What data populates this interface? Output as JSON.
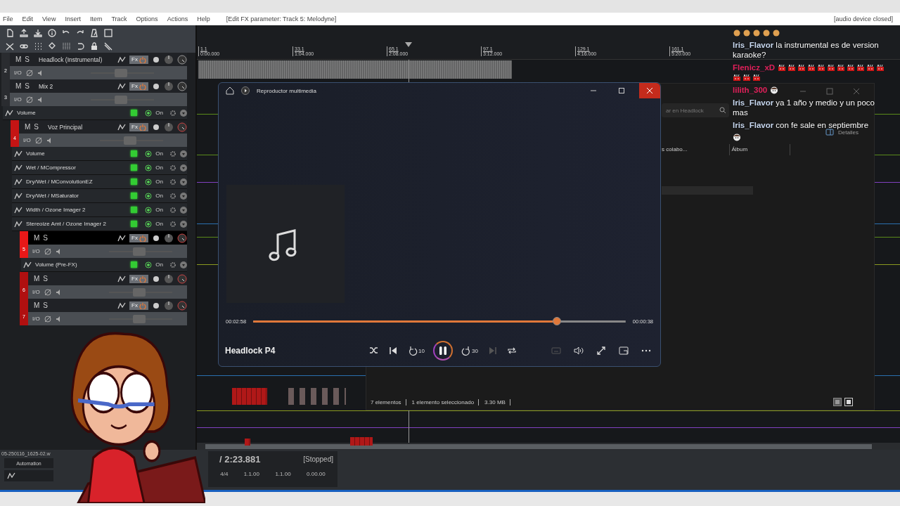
{
  "menu_bar": {
    "items": [
      "File",
      "Edit",
      "View",
      "Insert",
      "Item",
      "Track",
      "Options",
      "Actions",
      "Help"
    ],
    "title": "[Edit FX parameter: Track 5: Melodyne]",
    "status": "[audio device closed]"
  },
  "tracks": [
    {
      "number": "2",
      "name": "Headlock (Instrumental)",
      "mute": "M",
      "solo": "S",
      "fx": "Fx",
      "io": "I/O",
      "selected": false
    },
    {
      "number": "3",
      "name": "Mix 2",
      "mute": "M",
      "solo": "S",
      "fx": "Fx",
      "io": "I/O",
      "selected": false,
      "envelopes": [
        {
          "name": "Volume",
          "on": "On"
        }
      ],
      "children": [
        {
          "number": "4",
          "name": "Voz Principal",
          "color": "#c41414",
          "mute": "M",
          "solo": "S",
          "fx": "Fx",
          "io": "I/O",
          "selected": false,
          "envelopes": [
            {
              "name": "Volume",
              "on": "On"
            },
            {
              "name": "Wet / MCompressor",
              "on": "On"
            },
            {
              "name": "Dry/Wet / MConvolutionEZ",
              "on": "On"
            },
            {
              "name": "Dry/Wet / MSaturator",
              "on": "On"
            },
            {
              "name": "Width / Ozone Imager 2",
              "on": "On"
            },
            {
              "name": "Stereoize Amt / Ozone Imager 2",
              "on": "On"
            }
          ],
          "children": [
            {
              "number": "5",
              "color": "#e81818",
              "mute": "M",
              "solo": "S",
              "fx": "Fx",
              "io": "I/O",
              "selected": true,
              "envelopes": [
                {
                  "name": "Volume (Pre-FX)",
                  "on": "On"
                }
              ]
            },
            {
              "number": "6",
              "color": "#b01010",
              "mute": "M",
              "solo": "S",
              "fx": "Fx",
              "io": "I/O",
              "selected": false
            },
            {
              "number": "7",
              "color": "#b01010",
              "mute": "M",
              "solo": "S",
              "fx": "Fx",
              "io": "I/O",
              "selected": false
            }
          ]
        }
      ]
    }
  ],
  "ruler": {
    "markers": [
      {
        "bar": "1.1",
        "time": "0:00.000"
      },
      {
        "bar": "33.1",
        "time": "1:04.000"
      },
      {
        "bar": "65.1",
        "time": "2:08.000"
      },
      {
        "bar": "97.1",
        "time": "3:12.000"
      },
      {
        "bar": "129.1",
        "time": "4:16.000"
      },
      {
        "bar": "161.1",
        "time": "5:20.000"
      }
    ]
  },
  "bottom_panel": {
    "file_name": "05-250116_1625-02.w",
    "automation_button": "Automation",
    "position": "/ 2:23.881",
    "state": "[Stopped]",
    "readouts": [
      "4/4",
      "1.1.00",
      "1.1.00",
      "0.00.00"
    ]
  },
  "explorer": {
    "columns": [
      "s colabo...",
      "Álbum"
    ],
    "search": {
      "placeholder": "ar en Headlock"
    },
    "details_button": "Detalles",
    "status": [
      "7 elementos",
      "1 elemento seleccionado",
      "3.30 MB"
    ]
  },
  "media_player": {
    "title": "Reproductor multimedia",
    "elapsed": "00:02:58",
    "remaining": "00:00:38",
    "level": 0.815,
    "song_title": "Headlock P4",
    "playing": true,
    "controls": [
      {
        "kind": "shuffle",
        "disabled": false
      },
      {
        "kind": "previous",
        "disabled": false
      },
      {
        "kind": "back",
        "label": "10",
        "disabled": false
      },
      {
        "kind": "playpause",
        "disabled": false
      },
      {
        "kind": "forward",
        "label": "30",
        "disabled": false
      },
      {
        "kind": "next",
        "disabled": true
      },
      {
        "kind": "repeat",
        "disabled": false
      }
    ],
    "extra_controls": [
      {
        "kind": "captions",
        "disabled": true
      },
      {
        "kind": "volume",
        "disabled": false
      },
      {
        "kind": "fullscreen",
        "disabled": false
      },
      {
        "kind": "miniplayer",
        "disabled": false
      },
      {
        "kind": "more",
        "disabled": false
      }
    ]
  },
  "chat": {
    "messages": [
      {
        "kind": "coins"
      },
      {
        "kind": "text",
        "user": "Iris_Flavor",
        "color": "#c8d8f0",
        "text": "la instrumental es de version karaoke?"
      },
      {
        "kind": "cakes",
        "user": "Flenicz_xD",
        "color": "#e0205a"
      },
      {
        "kind": "face",
        "user": "lilith_300",
        "color": "#e0205a"
      },
      {
        "kind": "text",
        "user": "Iris_Flavor",
        "color": "#c8d8f0",
        "text": "ya 1 año y medio y un poco mas"
      },
      {
        "kind": "text",
        "user": "Iris_Flavor",
        "color": "#c8d8f0",
        "text": "con fe sale en septiembre"
      },
      {
        "kind": "face"
      }
    ]
  }
}
